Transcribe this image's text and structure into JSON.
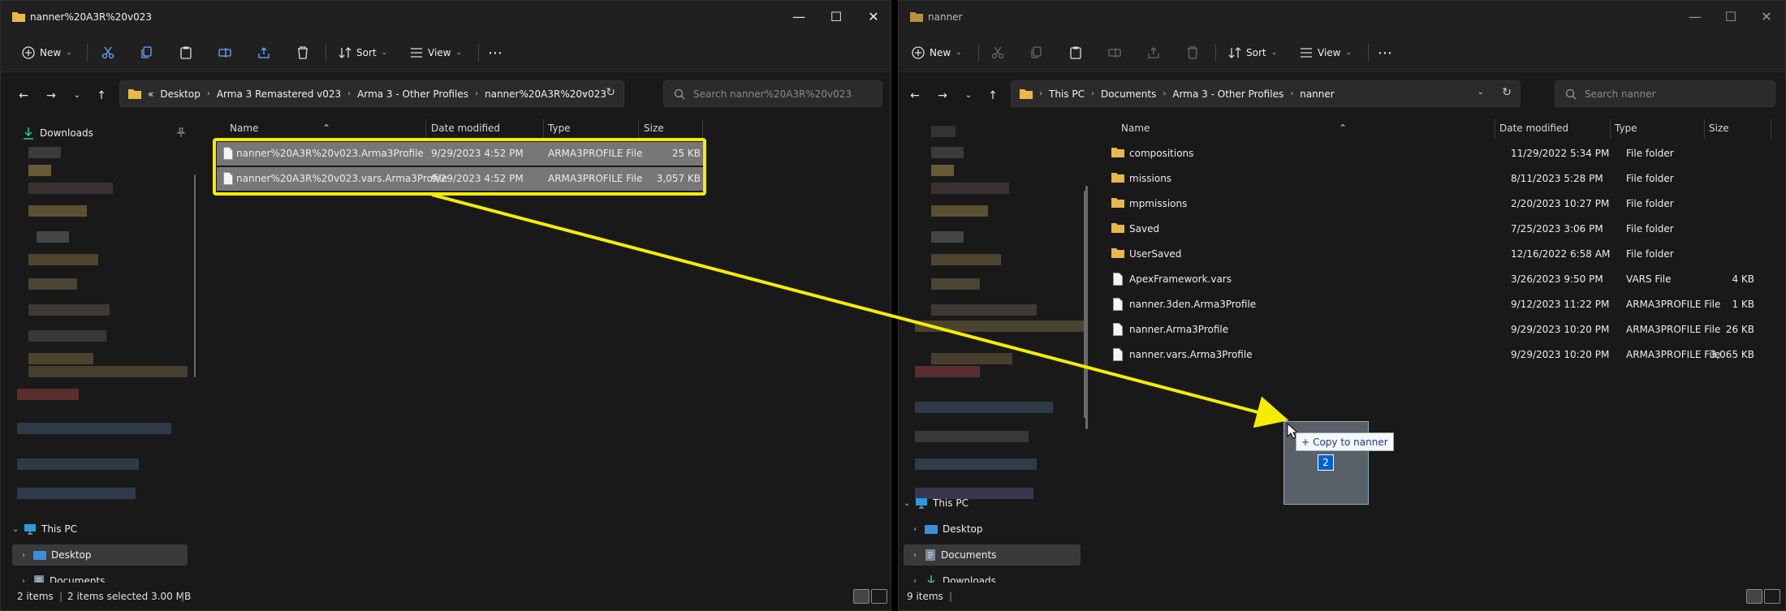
{
  "left": {
    "title": "nanner%20A3R%20v023",
    "toolbar": {
      "new": "New",
      "sort": "Sort",
      "view": "View"
    },
    "address": {
      "overflow": "«",
      "crumbs": [
        "Desktop",
        "Arma 3 Remastered v023",
        "Arma 3 - Other Profiles",
        "nanner%20A3R%20v023"
      ]
    },
    "search_placeholder": "Search nanner%20A3R%20v023",
    "sidebar": {
      "downloads": "Downloads",
      "this_pc": "This PC",
      "desktop": "Desktop",
      "documents": "Documents"
    },
    "columns": {
      "name": "Name",
      "date": "Date modified",
      "type": "Type",
      "size": "Size"
    },
    "files": [
      {
        "name": "nanner%20A3R%20v023.Arma3Profile",
        "date": "9/29/2023 4:52 PM",
        "type": "ARMA3PROFILE File",
        "size": "25 KB"
      },
      {
        "name": "nanner%20A3R%20v023.vars.Arma3Profile",
        "date": "9/29/2023 4:52 PM",
        "type": "ARMA3PROFILE File",
        "size": "3,057 KB"
      }
    ],
    "status": {
      "items": "2 items",
      "selected": "2 items selected  3.00 MB"
    }
  },
  "right": {
    "title": "nanner",
    "toolbar": {
      "new": "New",
      "sort": "Sort",
      "view": "View"
    },
    "address": {
      "crumbs": [
        "This PC",
        "Documents",
        "Arma 3 - Other Profiles",
        "nanner"
      ]
    },
    "search_placeholder": "Search nanner",
    "sidebar": {
      "this_pc": "This PC",
      "desktop": "Desktop",
      "documents": "Documents",
      "downloads": "Downloads"
    },
    "columns": {
      "name": "Name",
      "date": "Date modified",
      "type": "Type",
      "size": "Size"
    },
    "files": [
      {
        "name": "compositions",
        "date": "11/29/2022 5:34 PM",
        "type": "File folder",
        "size": "",
        "kind": "folder"
      },
      {
        "name": "missions",
        "date": "8/11/2023 5:28 PM",
        "type": "File folder",
        "size": "",
        "kind": "folder"
      },
      {
        "name": "mpmissions",
        "date": "2/20/2023 10:27 PM",
        "type": "File folder",
        "size": "",
        "kind": "folder"
      },
      {
        "name": "Saved",
        "date": "7/25/2023 3:06 PM",
        "type": "File folder",
        "size": "",
        "kind": "folder"
      },
      {
        "name": "UserSaved",
        "date": "12/16/2022 6:58 AM",
        "type": "File folder",
        "size": "",
        "kind": "folder"
      },
      {
        "name": "ApexFramework.vars",
        "date": "3/26/2023 9:50 PM",
        "type": "VARS File",
        "size": "4 KB",
        "kind": "file"
      },
      {
        "name": "nanner.3den.Arma3Profile",
        "date": "9/12/2023 11:22 PM",
        "type": "ARMA3PROFILE File",
        "size": "1 KB",
        "kind": "file"
      },
      {
        "name": "nanner.Arma3Profile",
        "date": "9/29/2023 10:20 PM",
        "type": "ARMA3PROFILE File",
        "size": "26 KB",
        "kind": "file"
      },
      {
        "name": "nanner.vars.Arma3Profile",
        "date": "9/29/2023 10:20 PM",
        "type": "ARMA3PROFILE File",
        "size": "3,065 KB",
        "kind": "file"
      }
    ],
    "status": {
      "items": "9 items"
    }
  },
  "drag": {
    "tooltip": "Copy to nanner",
    "count": "2"
  },
  "colors": {
    "highlight": "#f5ec00",
    "folder": "#e8b84a",
    "selection": "#777777",
    "badge": "#0060d0"
  }
}
